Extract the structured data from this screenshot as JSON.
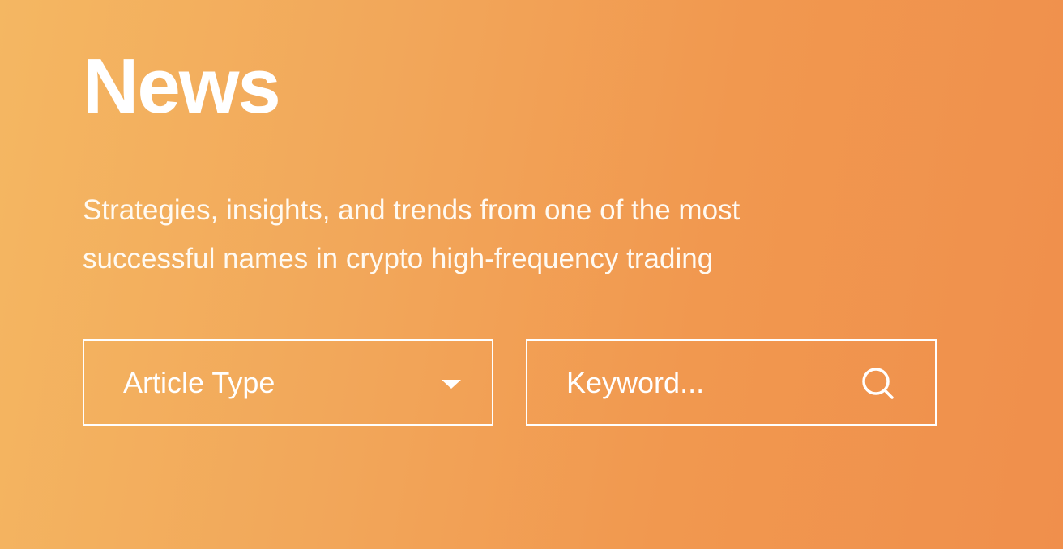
{
  "header": {
    "title": "News",
    "subtitle": "Strategies, insights, and trends from one of the most successful names in crypto high-frequency trading"
  },
  "filters": {
    "article_type": {
      "label": "Article Type",
      "icon": "chevron-down-icon"
    },
    "search": {
      "placeholder": "Keyword...",
      "value": "",
      "icon": "search-icon"
    }
  },
  "colors": {
    "gradient_start": "#f4b762",
    "gradient_end": "#f08f4c",
    "text": "#ffffff"
  }
}
